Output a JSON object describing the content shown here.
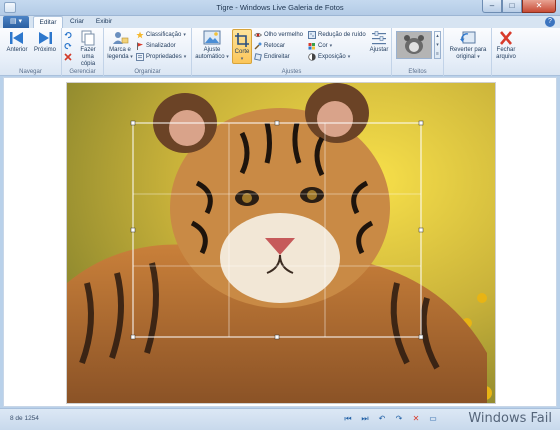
{
  "window": {
    "title": "Tigre - Windows Live Galeria de Fotos"
  },
  "tabs": [
    {
      "label": "Editar"
    },
    {
      "label": "Criar"
    },
    {
      "label": "Exibir"
    }
  ],
  "ribbon": {
    "groups": {
      "navegar": "Navegar",
      "gerenciar": "Gerenciar",
      "organizar": "Organizar",
      "ajustes": "Ajustes",
      "efeitos": "Efeitos"
    },
    "buttons": {
      "anterior": "Anterior",
      "proximo": "Próximo",
      "fazer_copia_1": "Fazer uma",
      "fazer_copia_2": "cópia",
      "marca_1": "Marca e",
      "marca_2": "legenda",
      "classificacao": "Classificação",
      "sinalizador": "Sinalizador",
      "propriedades": "Propriedades",
      "ajuste_auto_1": "Ajuste",
      "ajuste_auto_2": "automático",
      "corte": "Corte",
      "olho_vermelho": "Olho vermelho",
      "retocar": "Retocar",
      "endireitar": "Endireitar",
      "reducao_ruido": "Redução de ruído",
      "cor": "Cor",
      "exposicao": "Exposição",
      "ajustar": "Ajustar",
      "reverter_1": "Reverter para",
      "reverter_2": "original",
      "fechar_1": "Fechar",
      "fechar_2": "arquivo"
    }
  },
  "status": {
    "counter": "8 de 1254"
  },
  "watermark": "Windows Fail",
  "colors": {
    "accent": "#2a5fa2",
    "crop_selected": "#fbc65a",
    "ribbon_bg": "#e6eef8"
  }
}
